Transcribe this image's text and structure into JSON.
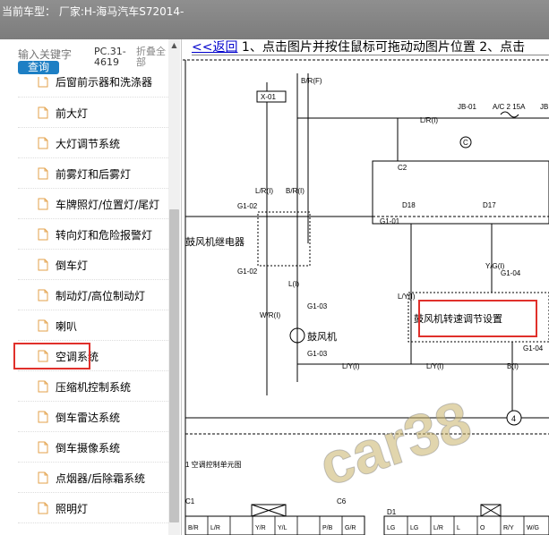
{
  "header": {
    "title": "当前车型： 厂家:H-海马汽车S72014-"
  },
  "sidebar": {
    "search_placeholder": "输入关键字",
    "search_button": "查询",
    "model_code": "PC.31-4619",
    "fold_all": "折叠全部",
    "items": [
      {
        "label": "后窗前示器和洗涤器"
      },
      {
        "label": "前大灯"
      },
      {
        "label": "大灯调节系统"
      },
      {
        "label": "前雾灯和后雾灯"
      },
      {
        "label": "车牌照灯/位置灯/尾灯"
      },
      {
        "label": "转向灯和危险报警灯"
      },
      {
        "label": "倒车灯"
      },
      {
        "label": "制动灯/高位制动灯"
      },
      {
        "label": "喇叭"
      },
      {
        "label": "空调系统"
      },
      {
        "label": "压缩机控制系统"
      },
      {
        "label": "倒车雷达系统"
      },
      {
        "label": "倒车摄像系统"
      },
      {
        "label": "点烟器/后除霜系统"
      },
      {
        "label": "照明灯"
      }
    ],
    "selected_index": 9
  },
  "content": {
    "back_link": "<<返回",
    "instructions": " 1、点击图片并按住鼠标可拖动动图片位置 2、点击",
    "diagram": {
      "labels": {
        "x01": "X-01",
        "brf": "B/R(F)",
        "jb01": "JB-01",
        "ac_fuse": "A/C 2 15A",
        "jb_cut": "JB",
        "c_circle": "C",
        "lr_top": "L/R(I)",
        "c2": "C2",
        "lr_left": "L/R(I)",
        "br_left": "B/R(I)",
        "g102_a": "G1-02",
        "g102_b": "G1-02",
        "relay": "鼓风机继电器",
        "d18": "D18",
        "d17": "D17",
        "g101": "G1-01",
        "yg": "Y/G(I)",
        "g104": "G1-04",
        "ly": "L/Y(I)",
        "resistor": "鼓风机转速调节设置",
        "l_mid": "L(I)",
        "g103_a": "G1-03",
        "blower": "鼓风机",
        "wr": "W/R(I)",
        "g103_b": "G1-03",
        "g18_cut": "G1-04",
        "ly_bottom": "L/Y(I)",
        "ly_bottom2": "L/Y(I)",
        "b_right": "B(I)",
        "ground": "4",
        "ac_ctrl": "1  空调控制单元图",
        "c1": "C1",
        "c6": "C6",
        "d1": "D1",
        "conn_left": [
          "B/R",
          "L/R",
          "",
          "Y/R",
          "Y/L",
          "",
          "P/B",
          "G/R"
        ],
        "conn_right": [
          "LG",
          "LG",
          "L/R",
          "L",
          "O",
          "R/Y",
          "W/G"
        ]
      }
    },
    "watermark": "car38"
  }
}
